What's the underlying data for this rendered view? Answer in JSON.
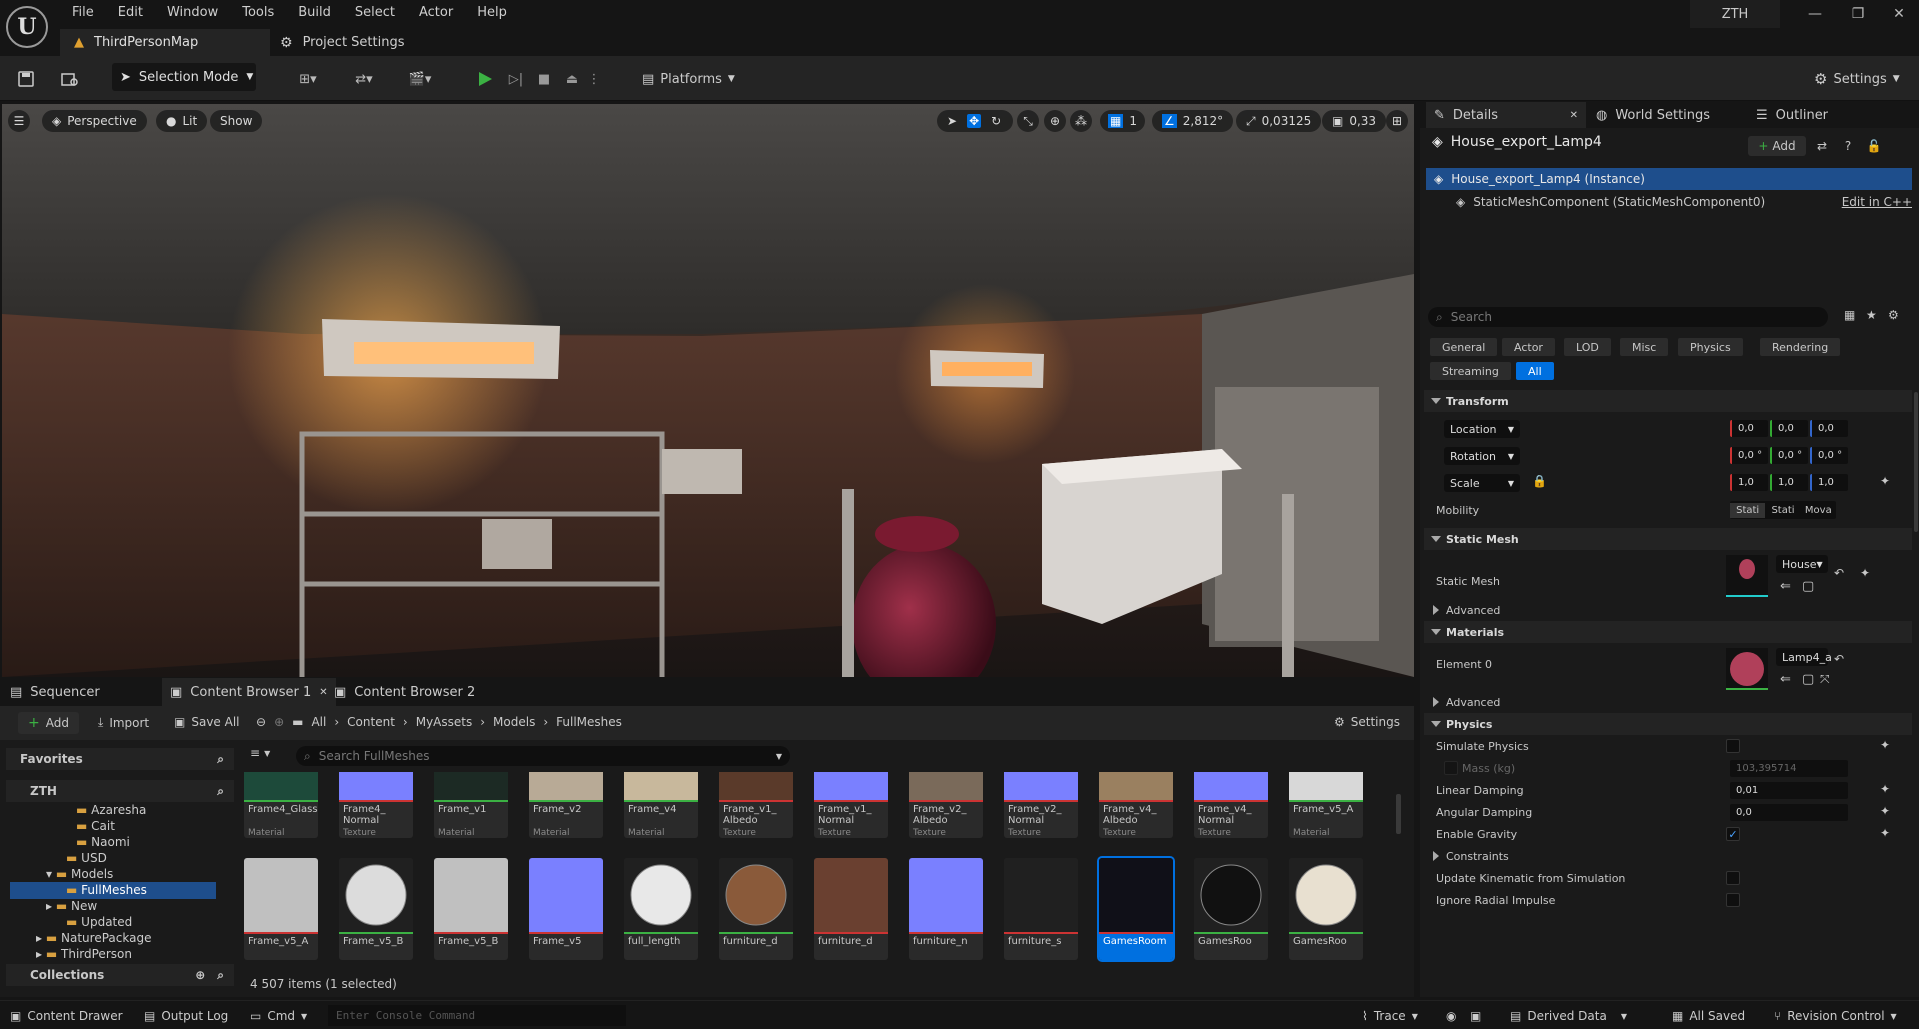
{
  "app": {
    "logo": "U",
    "user": "ZTH",
    "map_tab": "ThirdPersonMap",
    "project_settings": "Project Settings"
  },
  "menu": [
    "File",
    "Edit",
    "Window",
    "Tools",
    "Build",
    "Select",
    "Actor",
    "Help"
  ],
  "toolbar": {
    "selection_mode": "Selection Mode",
    "platforms": "Platforms",
    "settings": "Settings"
  },
  "viewport": {
    "perspective": "Perspective",
    "lit": "Lit",
    "show": "Show",
    "grid": "1",
    "angle": "2,812°",
    "scale": "0,03125",
    "camera": "0,33"
  },
  "details": {
    "tabs": [
      "Details",
      "World Settings",
      "Outliner"
    ],
    "actor": "House_export_Lamp4",
    "add": "Add",
    "instance": "House_export_Lamp4 (Instance)",
    "component": "StaticMeshComponent (StaticMeshComponent0)",
    "edit_cpp": "Edit in C++",
    "search_placeholder": "Search",
    "filters": [
      "General",
      "Actor",
      "LOD",
      "Misc",
      "Physics",
      "Rendering",
      "Streaming",
      "All"
    ],
    "transform": {
      "title": "Transform",
      "location": "Location",
      "rotation": "Rotation",
      "scale": "Scale",
      "loc": [
        "0,0",
        "0,0",
        "0,0"
      ],
      "rot": [
        "0,0 °",
        "0,0 °",
        "0,0 °"
      ],
      "scl": [
        "1,0",
        "1,0",
        "1,0"
      ],
      "mobility": "Mobility",
      "mob_opts": [
        "Stati",
        "Stati",
        "Mova"
      ]
    },
    "static_mesh": {
      "title": "Static Mesh",
      "label": "Static Mesh",
      "value": "House",
      "advanced": "Advanced"
    },
    "materials": {
      "title": "Materials",
      "element": "Element 0",
      "value": "Lamp4_a",
      "advanced": "Advanced"
    },
    "physics": {
      "title": "Physics",
      "simulate": "Simulate Physics",
      "mass": "Mass (kg)",
      "mass_val": "103,395714",
      "linear": "Linear Damping",
      "linear_val": "0,01",
      "angular": "Angular Damping",
      "angular_val": "0,0",
      "gravity": "Enable Gravity",
      "constraints": "Constraints",
      "kinematic": "Update Kinematic from Simulation",
      "radial": "Ignore Radial Impulse"
    }
  },
  "content": {
    "tabs": [
      "Sequencer",
      "Content Browser 1",
      "Content Browser 2"
    ],
    "add": "Add",
    "import": "Import",
    "save_all": "Save All",
    "settings": "Settings",
    "path": [
      "All",
      "Content",
      "MyAssets",
      "Models",
      "FullMeshes"
    ],
    "favorites": "Favorites",
    "root": "ZTH",
    "collections": "Collections",
    "tree": [
      "Azaresha",
      "Cait",
      "Naomi",
      "USD",
      "Models",
      "FullMeshes",
      "New",
      "Updated",
      "NaturePackage",
      "ThirdPerson"
    ],
    "search_placeholder": "Search FullMeshes",
    "count": "4 507 items (1 selected)",
    "row1": [
      [
        "Frame4_Glass",
        "Material"
      ],
      [
        "Frame4_ Normal",
        "Texture"
      ],
      [
        "Frame_v1",
        "Material"
      ],
      [
        "Frame_v2",
        "Material"
      ],
      [
        "Frame_v4",
        "Material"
      ],
      [
        "Frame_v1_ Albedo",
        "Texture"
      ],
      [
        "Frame_v1_ Normal",
        "Texture"
      ],
      [
        "Frame_v2_ Albedo",
        "Texture"
      ],
      [
        "Frame_v2_ Normal",
        "Texture"
      ],
      [
        "Frame_v4_ Albedo",
        "Texture"
      ],
      [
        "Frame_v4_ Normal",
        "Texture"
      ],
      [
        "Frame_v5_A",
        "Material"
      ]
    ],
    "row2": [
      "Frame_v5_A",
      "Frame_v5_B",
      "Frame_v5_B",
      "Frame_v5",
      "full_length",
      "furniture_d",
      "furniture_d",
      "furniture_n",
      "furniture_s",
      "GamesRoom",
      "GamesRoo",
      "GamesRoo"
    ]
  },
  "status": {
    "drawer": "Content Drawer",
    "output": "Output Log",
    "cmd": "Cmd",
    "console_placeholder": "Enter Console Command",
    "trace": "Trace",
    "derived": "Derived Data",
    "saved": "All Saved",
    "revision": "Revision Control"
  },
  "colors": {
    "accent": "#0070e0",
    "play": "#3bb143",
    "selected_row": "#1e4e8c"
  }
}
